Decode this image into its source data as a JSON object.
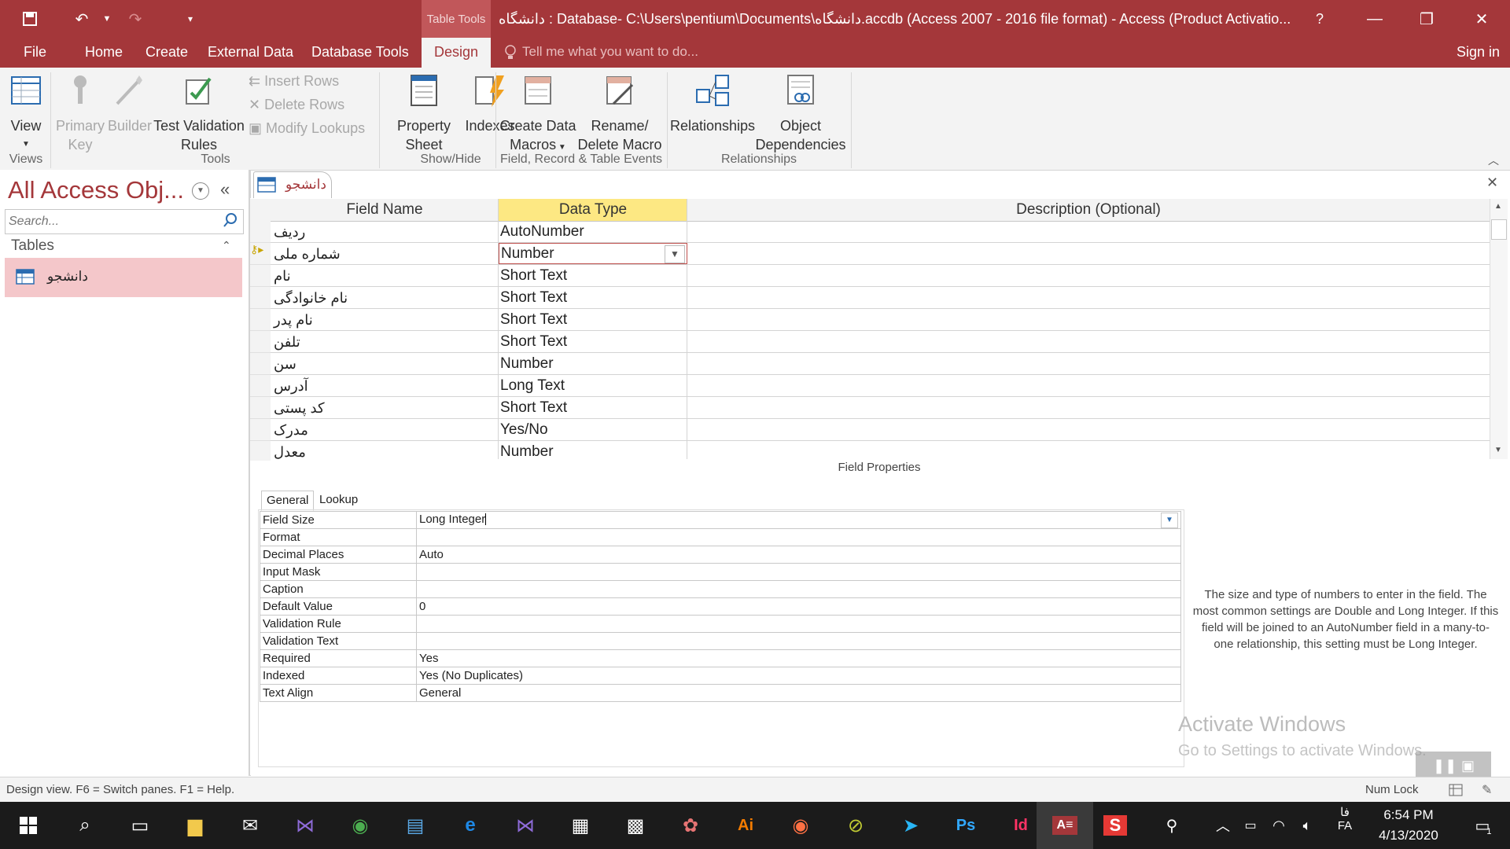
{
  "titlebar": {
    "context_tab": "Table Tools",
    "title": "دانشگاه : Database- C:\\Users\\pentium\\Documents\\دانشگاه.accdb (Access 2007 - 2016 file format) - Access (Product Activatio...",
    "help": "?"
  },
  "menu": {
    "tabs": [
      "File",
      "Home",
      "Create",
      "External Data",
      "Database Tools",
      "Design"
    ],
    "tell_me": "Tell me what you want to do...",
    "sign_in": "Sign in"
  },
  "ribbon": {
    "view": "View",
    "primary_key": [
      "Primary",
      "Key"
    ],
    "builder": "Builder",
    "test_validation": [
      "Test Validation",
      "Rules"
    ],
    "insert_rows": "Insert Rows",
    "delete_rows": "Delete Rows",
    "modify_lookups": "Modify Lookups",
    "property_sheet": [
      "Property",
      "Sheet"
    ],
    "indexes": "Indexes",
    "create_data_macros": [
      "Create Data",
      "Macros"
    ],
    "rename_delete_macro": [
      "Rename/",
      "Delete Macro"
    ],
    "relationships": "Relationships",
    "object_dependencies": [
      "Object",
      "Dependencies"
    ],
    "groups": {
      "views": "Views",
      "tools": "Tools",
      "show_hide": "Show/Hide",
      "field_events": "Field, Record & Table Events",
      "relationships": "Relationships"
    }
  },
  "nav": {
    "title": "All Access Obj...",
    "search_placeholder": "Search...",
    "section": "Tables",
    "items": [
      {
        "label": "دانشجو"
      }
    ]
  },
  "doc_tab": {
    "label": "دانشجو"
  },
  "grid": {
    "headers": {
      "field_name": "Field Name",
      "data_type": "Data Type",
      "description": "Description (Optional)"
    },
    "rows": [
      {
        "name": "ردیف",
        "type": "AutoNumber"
      },
      {
        "name": "شماره ملی",
        "type": "Number"
      },
      {
        "name": "نام",
        "type": "Short Text"
      },
      {
        "name": "نام خانوادگی",
        "type": "Short Text"
      },
      {
        "name": "نام پدر",
        "type": "Short Text"
      },
      {
        "name": "تلفن",
        "type": "Short Text"
      },
      {
        "name": "سن",
        "type": "Number"
      },
      {
        "name": "آدرس",
        "type": "Long Text"
      },
      {
        "name": "کد پستی",
        "type": "Short Text"
      },
      {
        "name": "مدرک",
        "type": "Yes/No"
      },
      {
        "name": "معدل",
        "type": "Number"
      }
    ]
  },
  "field_properties": {
    "label": "Field Properties",
    "tabs": [
      "General",
      "Lookup"
    ],
    "rows": [
      {
        "key": "Field Size",
        "value": "Long Integer"
      },
      {
        "key": "Format",
        "value": ""
      },
      {
        "key": "Decimal Places",
        "value": "Auto"
      },
      {
        "key": "Input Mask",
        "value": ""
      },
      {
        "key": "Caption",
        "value": ""
      },
      {
        "key": "Default Value",
        "value": "0"
      },
      {
        "key": "Validation Rule",
        "value": ""
      },
      {
        "key": "Validation Text",
        "value": ""
      },
      {
        "key": "Required",
        "value": "Yes"
      },
      {
        "key": "Indexed",
        "value": "Yes (No Duplicates)"
      },
      {
        "key": "Text Align",
        "value": "General"
      }
    ],
    "help": "The size and type of numbers to enter in the field. The most common settings are Double and Long Integer. If this field will be joined to an AutoNumber field in a many-to-one relationship, this setting must be Long Integer."
  },
  "watermark": {
    "line1": "Activate Windows",
    "line2": "Go to Settings to activate Windows."
  },
  "status": {
    "left": "Design view.  F6 = Switch panes.  F1 = Help.",
    "num_lock": "Num Lock"
  },
  "taskbar": {
    "lang1": "فا",
    "lang2": "FA",
    "time": "6:54 PM",
    "date": "4/13/2020",
    "notif_count": "1"
  },
  "colors": {
    "accent": "#a4373a",
    "highlight": "#f4c7ca",
    "header_selected": "#fff08a"
  }
}
